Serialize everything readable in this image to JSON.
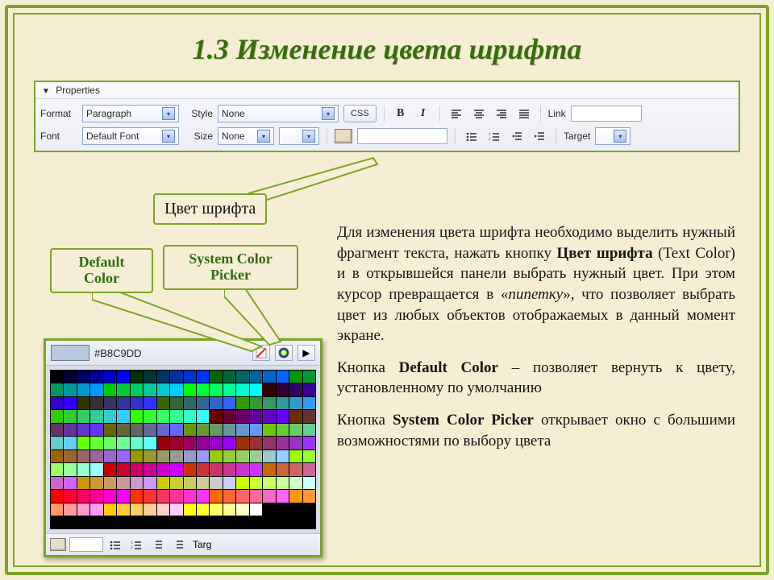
{
  "title": "1.3  Изменение цвета шрифта",
  "props": {
    "header": "Properties",
    "row1": {
      "format_label": "Format",
      "format_value": "Paragraph",
      "style_label": "Style",
      "style_value": "None",
      "css_btn": "CSS",
      "link_label": "Link"
    },
    "row2": {
      "font_label": "Font",
      "font_value": "Default Font",
      "size_label": "Size",
      "size_value": "None",
      "target_label": "Target"
    }
  },
  "callouts": {
    "text_color": "Цвет шрифта",
    "default_color_l1": "Default",
    "default_color_l2": "Color",
    "syscolor_l1": "System Color",
    "syscolor_l2": "Picker"
  },
  "picker": {
    "hex": "#B8C9DD",
    "bottom_label": "Targ"
  },
  "body": {
    "p1_a": "Для изменения цвета шрифта необходимо выделить нужный фрагмент текста, нажать кнопку ",
    "p1_b": "Цвет шрифта",
    "p1_c": " (Text Color) и в открывшейся панели выбрать нужный цвет. При этом курсор превращается в «",
    "p1_d": "пипетку",
    "p1_e": "», что позволяет выбрать цвет из любых объектов отображаемых в данный момент экране.",
    "p2_a": "Кнопка ",
    "p2_b": "Default Color",
    "p2_c": " – позволяет вернуть к цвету, установленному по умолчанию",
    "p3_a": "Кнопка ",
    "p3_b": "System Color Picker",
    "p3_c": " открывает окно с большими возможностями по выбору цвета"
  }
}
